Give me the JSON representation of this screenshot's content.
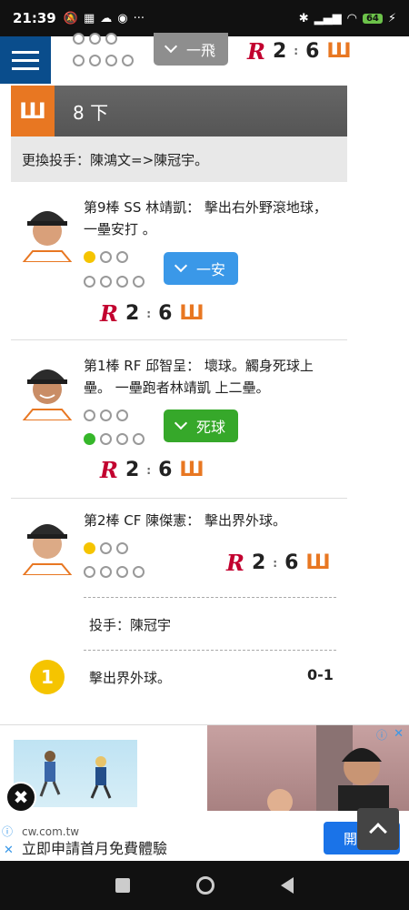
{
  "status": {
    "time": "21:39",
    "battery": "64",
    "more": "···"
  },
  "sticky": {
    "play": "一飛",
    "away_score": "2",
    "home_score": "6"
  },
  "inning": {
    "label": "8 下"
  },
  "change": {
    "text": "更換投手：陳鴻文=>陳冠宇。"
  },
  "events": [
    {
      "text": "第9棒 SS 林靖凱： 擊出右外野滾地球，一壘安打 。",
      "badge": "一安",
      "away": "2",
      "home": "6"
    },
    {
      "text": "第1棒 RF 邱智呈： 壞球。觸身死球上壘。 一壘跑者林靖凱 上二壘。",
      "badge": "死球",
      "away": "2",
      "home": "6"
    },
    {
      "text": "第2棒 CF 陳傑憲： 擊出界外球。",
      "away": "2",
      "home": "6"
    }
  ],
  "pitcher": {
    "label": "投手：陳冠宇"
  },
  "pitch": {
    "number": "1",
    "text": "擊出界外球。",
    "count": "0-1"
  },
  "ad": {
    "domain": "cw.com.tw",
    "title": "立即申請首月免費體驗",
    "button": "開"
  },
  "logos": {
    "away": "R",
    "home": "Ш"
  },
  "colors": {
    "menu": "#0a4d8c",
    "away": "#c2002f",
    "home": "#e87722",
    "ball": "#f5c400",
    "strike_green": "#36b72a"
  }
}
